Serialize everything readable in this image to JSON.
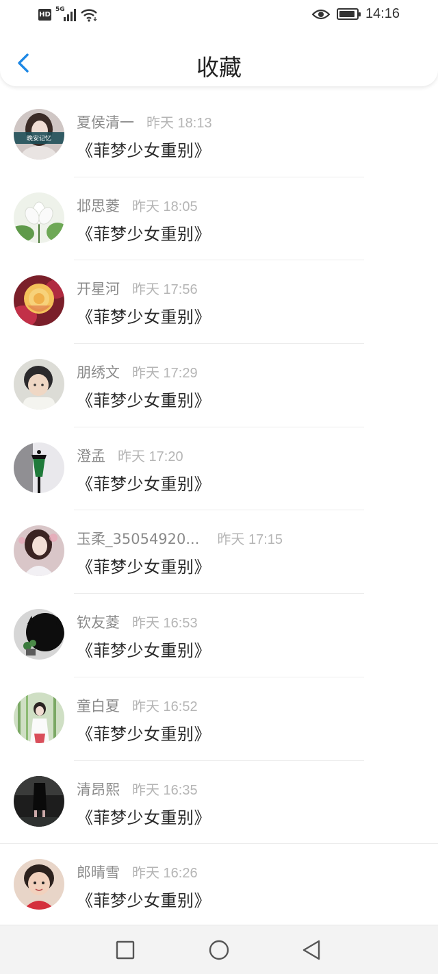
{
  "status_bar": {
    "network_badge": "HD",
    "network_type": "5G",
    "time": "14:16",
    "icons": [
      "hd-icon",
      "cellular-signal-icon",
      "wifi-icon",
      "eye-comfort-icon",
      "battery-icon"
    ]
  },
  "header": {
    "back_icon": "chevron-left-icon",
    "title": "收藏",
    "accent_color": "#1e88e5"
  },
  "favorites": [
    {
      "name": "夏侯清一",
      "time": "昨天 18:13",
      "title": "《菲梦少女重别》"
    },
    {
      "name": "邶思菱",
      "time": "昨天 18:05",
      "title": "《菲梦少女重别》"
    },
    {
      "name": "开星河",
      "time": "昨天 17:56",
      "title": "《菲梦少女重别》"
    },
    {
      "name": "朋绣文",
      "time": "昨天 17:29",
      "title": "《菲梦少女重别》"
    },
    {
      "name": "澄孟",
      "time": "昨天 17:20",
      "title": "《菲梦少女重别》"
    },
    {
      "name": "玉柔_35054920...",
      "time": "昨天 17:15",
      "title": "《菲梦少女重别》"
    },
    {
      "name": "钦友菱",
      "time": "昨天 16:53",
      "title": "《菲梦少女重别》"
    },
    {
      "name": "童白夏",
      "time": "昨天 16:52",
      "title": "《菲梦少女重别》"
    },
    {
      "name": "清昂熙",
      "time": "昨天 16:35",
      "title": "《菲梦少女重别》"
    },
    {
      "name": "郎晴雪",
      "time": "昨天 16:26",
      "title": "《菲梦少女重别》"
    }
  ],
  "avatar_1_caption": "晚安记忆",
  "nav_bar": {
    "icons": [
      "recent-apps-square-icon",
      "home-circle-icon",
      "back-triangle-icon"
    ]
  }
}
